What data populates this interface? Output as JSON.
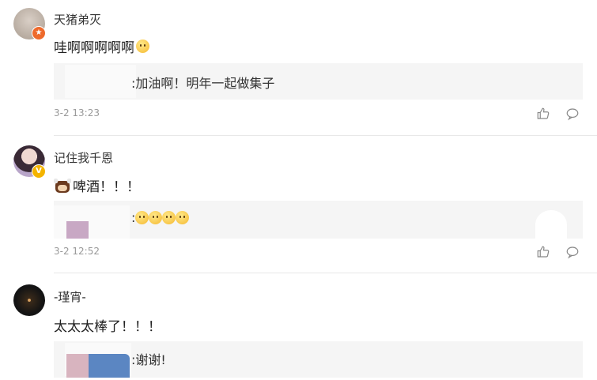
{
  "comments": [
    {
      "username": "天猪弟灭",
      "content": "哇啊啊啊啊啊",
      "reply": ":加油啊！明年一起做集子",
      "time": "3-2 13:23"
    },
    {
      "username": "记住我千恩",
      "content": "啤酒！！！",
      "reply": ":",
      "time": "3-2 12:52"
    },
    {
      "username": "-瑾宵-",
      "content": "太太太棒了！！！",
      "reply": ":谢谢!"
    }
  ],
  "icons": {
    "like": "thumbs-up-icon",
    "comment": "comment-bubble-icon",
    "verified_badge": "verified-v-badge",
    "orange_badge": "weibo-star-badge"
  },
  "colors": {
    "reply_bg": "#f5f5f5",
    "time_text": "#999999",
    "divider": "#e8e8e8",
    "verified_yellow": "#f4b400",
    "badge_orange": "#ee6a2c"
  }
}
